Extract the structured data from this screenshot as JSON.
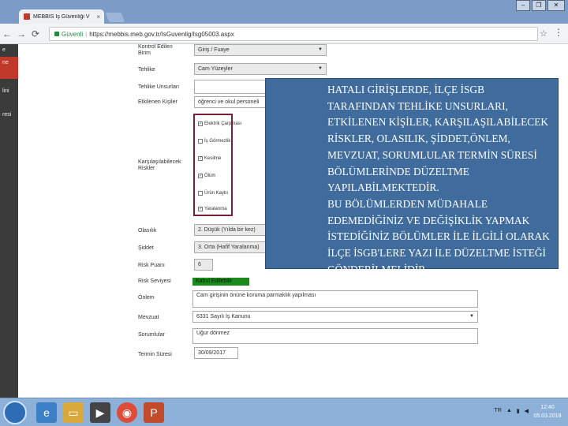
{
  "browser": {
    "tab_title": "MEBBİS İş Güvenliği V",
    "tab_close": "×",
    "window_controls": [
      "–",
      "❐",
      "✕"
    ],
    "back": "←",
    "forward": "→",
    "reload": "C",
    "secure_label": "Güvenli",
    "url": "https://mebbis.meb.gov.tr/IsGuvenlig/Isg05003.aspx",
    "star": "☆",
    "menu": "⋮"
  },
  "sidebar": {
    "items": [
      {
        "label": "e",
        "active": false
      },
      {
        "label": "ne",
        "active": true
      },
      {
        "label": "lini",
        "active": false
      },
      {
        "label": "resi",
        "active": false
      }
    ]
  },
  "form": {
    "kontrol_label": "Kontrol Edilen Birim",
    "kontrol_value": "Giriş / Fuaye",
    "tehlike_label": "Tehlike",
    "tehlike_value": "Cam Yüzeyler",
    "tehlike_unsurlari_label": "Tehlike Unsurları",
    "etkilenen_label": "Etkilenen Kişiler",
    "etkilenen_value": "öğrenci ve okul personeli",
    "riskler_label": "Karşılaşılabilecek Riskler",
    "checkboxes": [
      {
        "label": "Elektrik Çarpması",
        "checked": true
      },
      {
        "label": "İş Görmezlik",
        "checked": false
      },
      {
        "label": "Kesilme",
        "checked": true
      },
      {
        "label": "Ölüm",
        "checked": true
      },
      {
        "label": "Ürün Kaybı",
        "checked": false
      },
      {
        "label": "Yaralanma",
        "checked": true
      }
    ],
    "olasilik_label": "Olasılık",
    "olasilik_value": "2. Düşük (Yılda bir kez)",
    "siddet_label": "Şiddet",
    "siddet_value": "3. Orta (Hafif Yaralanma)",
    "risk_puani_label": "Risk Puanı",
    "risk_puani_value": "6",
    "risk_seviyesi_label": "Risk Seviyesi",
    "risk_seviyesi_value": "Kabul Edilebilir",
    "onlem_label": "Önlem",
    "onlem_value": "Cam girişinin önüne koruma parmaklık yapılması",
    "mevzuat_label": "Mevzuat",
    "mevzuat_value": "6331 Sayılı İş Kanunu",
    "sorumlular_label": "Sorumlular",
    "sorumlular_value": "Uğur dönmez",
    "termin_label": "Termin Süresi",
    "termin_value": "30/09/2017",
    "colon": ":"
  },
  "overlay": {
    "paragraph1": "HATALI GİRİŞLERDE, İLÇE İSGB TARAFINDAN TEHLİKE UNSURLARI, ETKİLENEN KİŞİLER, KARŞILAŞILABİLECEK RİSKLER, OLASILIK, ŞİDDET,ÖNLEM, MEVZUAT, SORUMLULAR TERMİN SÜRESİ BÖLÜMLERİNDE DÜZELTME YAPILABİLMEKTEDİR.",
    "paragraph2": "BU BÖLÜMLERDEN MÜDAHALE EDEMEDİĞİNİZ VE DEĞİŞİKLİK YAPMAK İSTEDİĞİNİZ BÖLÜMLER İLE İLGİLİ OLARAK İLÇE İSGB'LERE YAZI İLE DÜZELTME İSTEĞİ GÖNDERİLMELİDİR."
  },
  "taskbar": {
    "tray": "TR",
    "time": "12:40",
    "date": "05.03.2018"
  },
  "colors": {
    "overlay_bg": "#3f6c9d",
    "sidebar_active": "#c0392b",
    "risk_green": "#1a8a1a",
    "checkbox_border": "#7a1e3a"
  }
}
